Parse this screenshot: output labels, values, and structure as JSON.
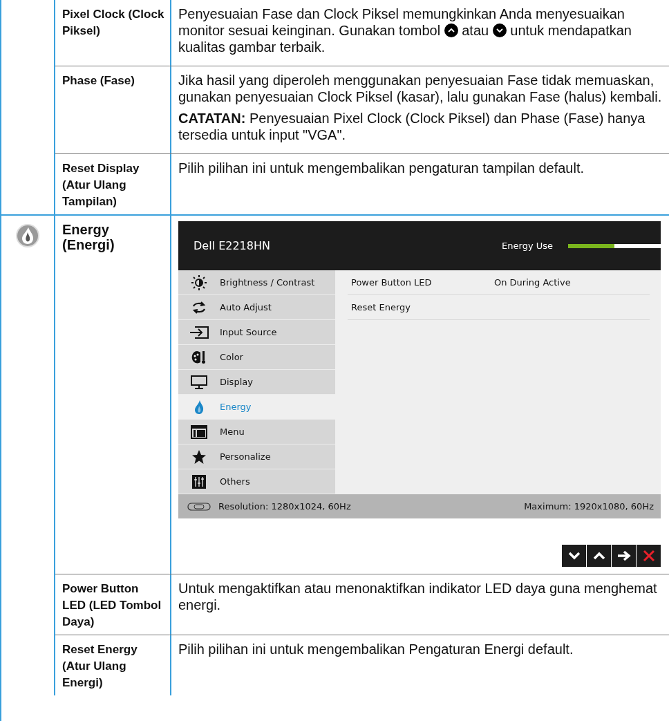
{
  "sections": [
    {
      "has_icon": false,
      "options": [
        {
          "label": "Pixel Clock (Clock Piksel)",
          "paragraphs": [
            [
              {
                "kind": "text",
                "text": "Penyesuaian Fase dan Clock Piksel memungkinkan Anda menyesuaikan monitor sesuai keinginan. Gunakan tombol"
              },
              {
                "kind": "up"
              },
              {
                "kind": "text",
                "text": "atau"
              },
              {
                "kind": "down"
              },
              {
                "kind": "text",
                "text": "untuk mendapatkan kualitas gambar terbaik."
              }
            ]
          ]
        },
        {
          "label": "Phase (Fase)",
          "paragraphs": [
            [
              {
                "kind": "text",
                "text": "Jika hasil yang diperoleh menggunakan penyesuaian Fase tidak memuaskan, gunakan penyesuaian Clock Piksel (kasar), lalu gunakan Fase (halus) kembali."
              }
            ],
            [
              {
                "kind": "text",
                "text": "**CATATAN:** Penyesuaian Pixel Clock (Clock Piksel) dan Phase (Fase) hanya tersedia untuk input \"VGA\"."
              }
            ]
          ]
        },
        {
          "label": "Reset Display (Atur Ulang Tampilan)",
          "paragraphs": [
            [
              {
                "kind": "text",
                "text": "Pilih pilihan ini untuk mengembalikan pengaturan tampilan default."
              }
            ]
          ]
        }
      ]
    },
    {
      "has_icon": true,
      "title": "Energy (Energi)",
      "osd": {
        "model": "Dell E2218HN",
        "meter_label": "Energy Use",
        "level": 0.5,
        "menu": [
          {
            "kind": "brightness",
            "label": "Brightness / Contrast",
            "selected": false
          },
          {
            "kind": "auto",
            "label": "Auto Adjust",
            "selected": false
          },
          {
            "kind": "input",
            "label": "Input Source",
            "selected": false
          },
          {
            "kind": "color",
            "label": "Color",
            "selected": false
          },
          {
            "kind": "display",
            "label": "Display",
            "selected": false
          },
          {
            "kind": "energy",
            "label": "Energy",
            "selected": true
          },
          {
            "kind": "menu",
            "label": "Menu",
            "selected": false
          },
          {
            "kind": "personalize",
            "label": "Personalize",
            "selected": false
          },
          {
            "kind": "others",
            "label": "Others",
            "selected": false
          }
        ],
        "settings": [
          {
            "name": "Power Button LED",
            "value": "On During Active"
          },
          {
            "name": "Reset Energy"
          }
        ],
        "resolution": "Resolution: 1280x1024, 60Hz",
        "maximum": "Maximum: 1920x1080, 60Hz",
        "buttons": [
          {
            "kind": "down"
          },
          {
            "kind": "up"
          },
          {
            "kind": "right"
          },
          {
            "kind": "close"
          }
        ]
      },
      "options": [
        {
          "label": "Power Button LED (LED Tombol Daya)",
          "paragraphs": [
            [
              {
                "kind": "text",
                "text": "Untuk mengaktifkan atau menonaktifkan indikator LED daya guna menghemat energi."
              }
            ]
          ]
        },
        {
          "label": "Reset Energy (Atur Ulang Energi)",
          "paragraphs": [
            [
              {
                "kind": "text",
                "text": "Pilih pilihan ini untuk mengembalikan Pengaturan Energi default."
              }
            ]
          ]
        }
      ]
    }
  ]
}
